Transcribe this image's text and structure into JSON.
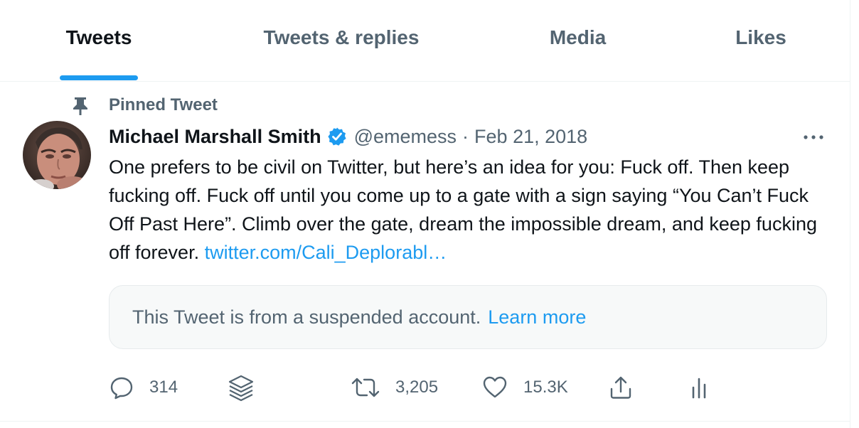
{
  "tabs": [
    {
      "label": "Tweets",
      "active": true
    },
    {
      "label": "Tweets & replies",
      "active": false
    },
    {
      "label": "Media",
      "active": false
    },
    {
      "label": "Likes",
      "active": false
    }
  ],
  "tweet": {
    "pinned_label": "Pinned Tweet",
    "display_name": "Michael Marshall Smith",
    "handle": "@ememess",
    "separator": "·",
    "date": "Feb 21, 2018",
    "text": "One prefers to be civil on Twitter, but here’s an idea for you: Fuck off. Then keep fucking off. Fuck off until you come up to a gate with a sign saying “You Can’t Fuck Off Past Here”. Climb over the gate, dream the impossible dream, and keep fucking off forever.",
    "link_text": "twitter.com/Cali_Deplorabl…",
    "suspended_notice": "This Tweet is from a suspended account.",
    "learn_more": "Learn more",
    "counts": {
      "replies": "314",
      "retweets": "3,205",
      "likes": "15.3K"
    }
  },
  "icons": [
    "pin-icon",
    "verified-badge-icon",
    "more-icon",
    "reply-icon",
    "stack-icon",
    "retweet-icon",
    "like-icon",
    "share-icon",
    "analytics-icon"
  ],
  "colors": {
    "accent": "#1d9bf0",
    "text_primary": "#0f1419",
    "text_secondary": "#536471",
    "border": "#eff3f4",
    "notice_bg": "#f7f9f9"
  }
}
